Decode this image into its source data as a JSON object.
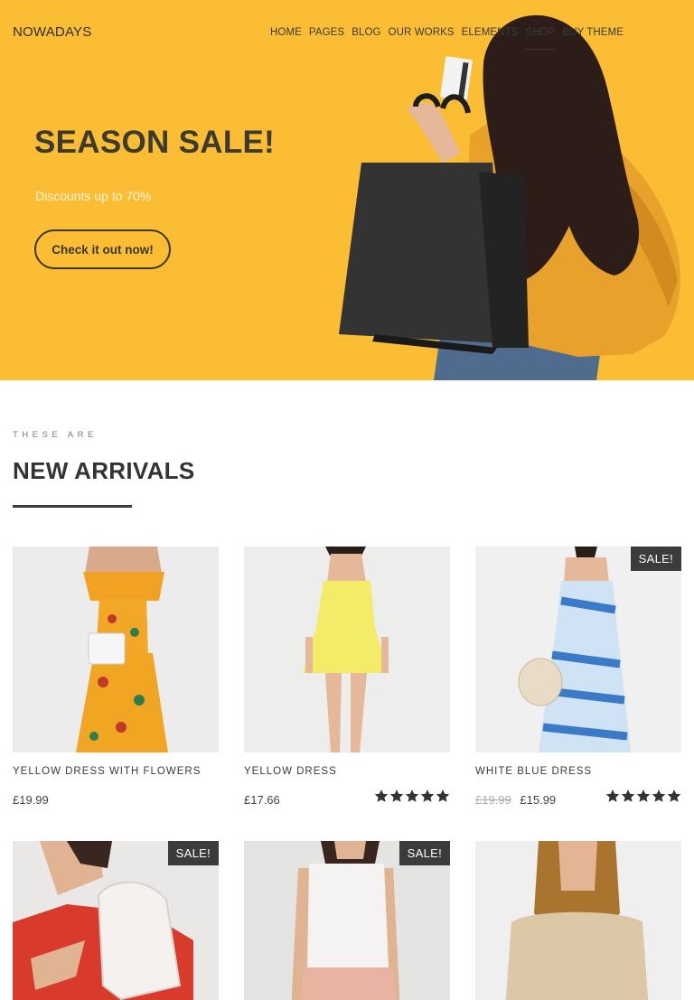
{
  "brand": {
    "logo": "NOWADAYS",
    "accent": "#fbbd33"
  },
  "nav": {
    "items": [
      {
        "label": "HOME"
      },
      {
        "label": "PAGES"
      },
      {
        "label": "BLOG"
      },
      {
        "label": "OUR WORKS"
      },
      {
        "label": "ELEMENTS"
      },
      {
        "label": "SHOP",
        "active": true
      },
      {
        "label": "BUY THEME"
      }
    ]
  },
  "hero": {
    "title": "SEASON SALE!",
    "subtitle": "Discounts up to 70%",
    "button_label": "Check it out now!"
  },
  "section": {
    "kicker": "THESE ARE",
    "title": "NEW ARRIVALS"
  },
  "products": [
    {
      "name": "YELLOW DRESS WITH FLOWERS",
      "price": "£19.99",
      "old_price": "",
      "sale": false,
      "badge": "",
      "rating": 0
    },
    {
      "name": "YELLOW DRESS",
      "price": "£17.66",
      "old_price": "",
      "sale": false,
      "badge": "",
      "rating": 5
    },
    {
      "name": "WHITE BLUE DRESS",
      "price": "£15.99",
      "old_price": "£19.99",
      "sale": true,
      "badge": "SALE!",
      "rating": 5
    },
    {
      "name": "",
      "price": "",
      "old_price": "",
      "sale": true,
      "badge": "SALE!",
      "rating": 0
    },
    {
      "name": "",
      "price": "",
      "old_price": "",
      "sale": true,
      "badge": "SALE!",
      "rating": 0
    },
    {
      "name": "",
      "price": "",
      "old_price": "",
      "sale": false,
      "badge": "",
      "rating": 0
    }
  ]
}
